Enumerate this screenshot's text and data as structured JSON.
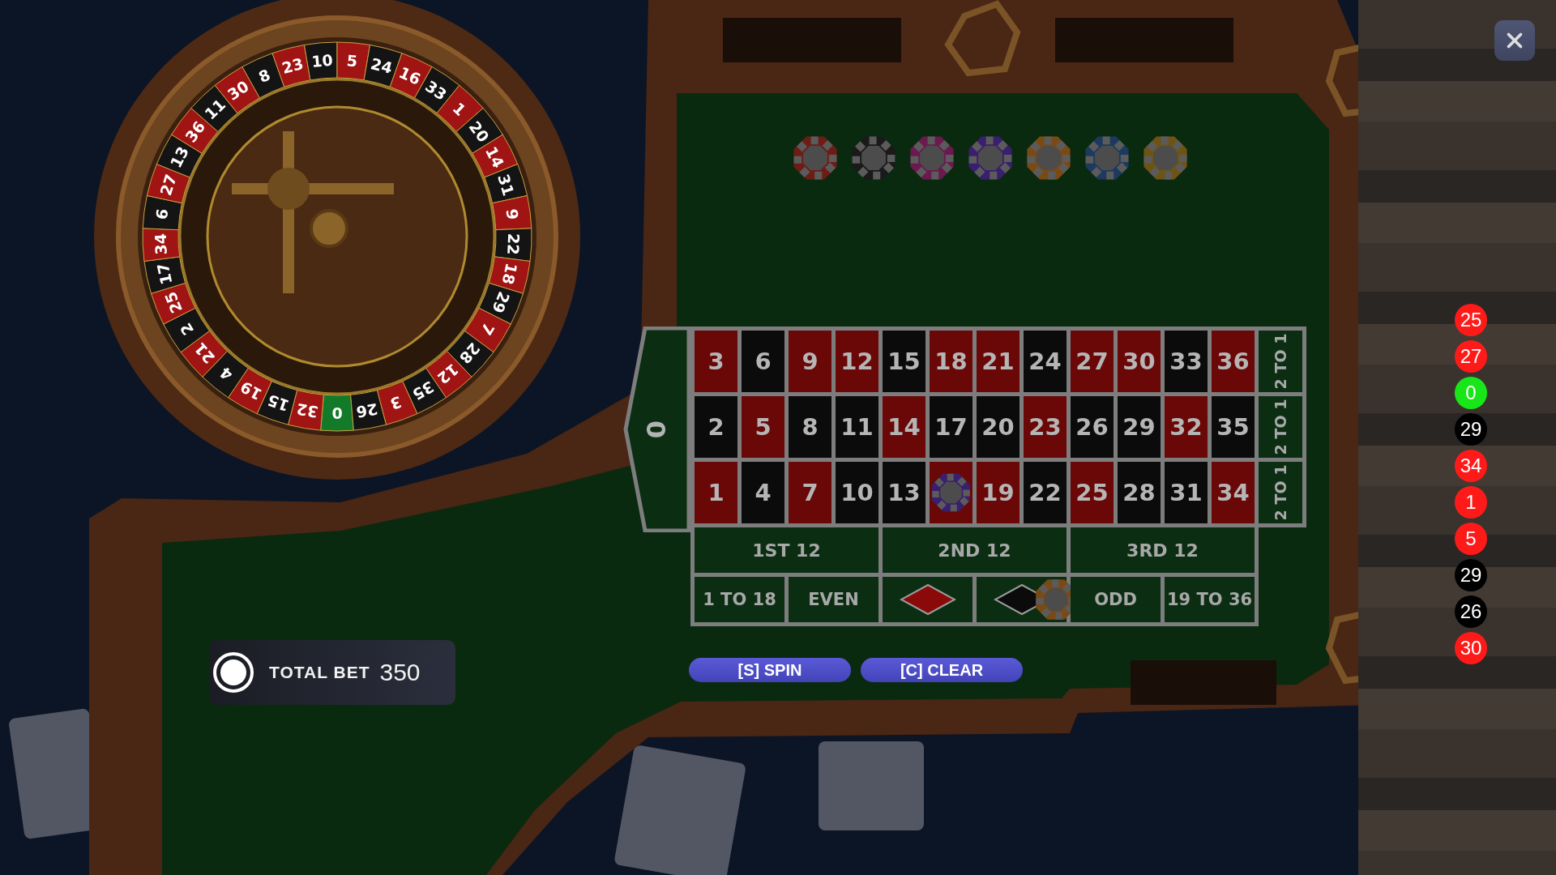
{
  "wheel": {
    "pockets": [
      {
        "number": "0",
        "color": "#137a2a"
      },
      {
        "number": "32",
        "color": "#a01414"
      },
      {
        "number": "15",
        "color": "#141414"
      },
      {
        "number": "19",
        "color": "#a01414"
      },
      {
        "number": "4",
        "color": "#141414"
      },
      {
        "number": "21",
        "color": "#a01414"
      },
      {
        "number": "2",
        "color": "#141414"
      },
      {
        "number": "25",
        "color": "#a01414"
      },
      {
        "number": "17",
        "color": "#141414"
      },
      {
        "number": "34",
        "color": "#a01414"
      },
      {
        "number": "6",
        "color": "#141414"
      },
      {
        "number": "27",
        "color": "#a01414"
      },
      {
        "number": "13",
        "color": "#141414"
      },
      {
        "number": "36",
        "color": "#a01414"
      },
      {
        "number": "11",
        "color": "#141414"
      },
      {
        "number": "30",
        "color": "#a01414"
      },
      {
        "number": "8",
        "color": "#141414"
      },
      {
        "number": "23",
        "color": "#a01414"
      },
      {
        "number": "10",
        "color": "#141414"
      },
      {
        "number": "5",
        "color": "#a01414"
      },
      {
        "number": "24",
        "color": "#141414"
      },
      {
        "number": "16",
        "color": "#a01414"
      },
      {
        "number": "33",
        "color": "#141414"
      },
      {
        "number": "1",
        "color": "#a01414"
      },
      {
        "number": "20",
        "color": "#141414"
      },
      {
        "number": "14",
        "color": "#a01414"
      },
      {
        "number": "31",
        "color": "#141414"
      },
      {
        "number": "9",
        "color": "#a01414"
      },
      {
        "number": "22",
        "color": "#141414"
      },
      {
        "number": "18",
        "color": "#a01414"
      },
      {
        "number": "29",
        "color": "#141414"
      },
      {
        "number": "7",
        "color": "#a01414"
      },
      {
        "number": "28",
        "color": "#141414"
      },
      {
        "number": "12",
        "color": "#a01414"
      },
      {
        "number": "35",
        "color": "#141414"
      },
      {
        "number": "3",
        "color": "#a01414"
      },
      {
        "number": "26",
        "color": "#141414"
      }
    ]
  },
  "chip_rack": [
    {
      "color": "#6b1d16"
    },
    {
      "color": "#1a1a1a"
    },
    {
      "color": "#6a1a4e"
    },
    {
      "color": "#3a1f6e"
    },
    {
      "color": "#7a4a14"
    },
    {
      "color": "#1d3a5e"
    },
    {
      "color": "#6e5414"
    }
  ],
  "board": {
    "zero": "0",
    "rows": [
      [
        {
          "number": "3",
          "color": "#6a0707"
        },
        {
          "number": "6",
          "color": "#0b0b0b"
        },
        {
          "number": "9",
          "color": "#6a0707"
        },
        {
          "number": "12",
          "color": "#6a0707"
        },
        {
          "number": "15",
          "color": "#0b0b0b"
        },
        {
          "number": "18",
          "color": "#6a0707"
        },
        {
          "number": "21",
          "color": "#6a0707"
        },
        {
          "number": "24",
          "color": "#0b0b0b"
        },
        {
          "number": "27",
          "color": "#6a0707"
        },
        {
          "number": "30",
          "color": "#6a0707"
        },
        {
          "number": "33",
          "color": "#0b0b0b"
        },
        {
          "number": "36",
          "color": "#6a0707"
        }
      ],
      [
        {
          "number": "2",
          "color": "#0b0b0b"
        },
        {
          "number": "5",
          "color": "#6a0707"
        },
        {
          "number": "8",
          "color": "#0b0b0b"
        },
        {
          "number": "11",
          "color": "#0b0b0b"
        },
        {
          "number": "14",
          "color": "#6a0707"
        },
        {
          "number": "17",
          "color": "#0b0b0b"
        },
        {
          "number": "20",
          "color": "#0b0b0b"
        },
        {
          "number": "23",
          "color": "#6a0707"
        },
        {
          "number": "26",
          "color": "#0b0b0b"
        },
        {
          "number": "29",
          "color": "#0b0b0b"
        },
        {
          "number": "32",
          "color": "#6a0707"
        },
        {
          "number": "35",
          "color": "#0b0b0b"
        }
      ],
      [
        {
          "number": "1",
          "color": "#6a0707"
        },
        {
          "number": "4",
          "color": "#0b0b0b"
        },
        {
          "number": "7",
          "color": "#6a0707"
        },
        {
          "number": "10",
          "color": "#0b0b0b"
        },
        {
          "number": "13",
          "color": "#0b0b0b"
        },
        {
          "color": "#6a0707",
          "chip": {
            "color": "#3a1f6e"
          }
        },
        {
          "number": "19",
          "color": "#6a0707"
        },
        {
          "number": "22",
          "color": "#0b0b0b"
        },
        {
          "number": "25",
          "color": "#6a0707"
        },
        {
          "number": "28",
          "color": "#0b0b0b"
        },
        {
          "number": "31",
          "color": "#0b0b0b"
        },
        {
          "number": "34",
          "color": "#6a0707"
        }
      ]
    ],
    "column_bets": [
      "2 TO 1",
      "2 TO 1",
      "2 TO 1"
    ],
    "dozens": [
      "1ST 12",
      "2ND 12",
      "3RD 12"
    ],
    "outside": [
      {
        "kind": "text",
        "label": "1 TO 18"
      },
      {
        "kind": "text",
        "label": "EVEN"
      },
      {
        "kind": "diamond",
        "color": "#8a0a0a"
      },
      {
        "kind": "diamond",
        "color": "#0b0b0b",
        "chip": {
          "color": "#7a4a14"
        }
      },
      {
        "kind": "text",
        "label": "ODD"
      },
      {
        "kind": "text",
        "label": "19 TO 36"
      }
    ]
  },
  "total_bet": {
    "label": "TOTAL BET",
    "value": "350"
  },
  "buttons": [
    "[S] SPIN",
    "[C] CLEAR"
  ],
  "history": [
    {
      "number": "25",
      "color": "#ff1a1a"
    },
    {
      "number": "27",
      "color": "#ff1a1a"
    },
    {
      "number": "0",
      "color": "#19e619"
    },
    {
      "number": "29",
      "color": "#000000"
    },
    {
      "number": "34",
      "color": "#ff1a1a"
    },
    {
      "number": "1",
      "color": "#ff1a1a"
    },
    {
      "number": "5",
      "color": "#ff1a1a"
    },
    {
      "number": "29",
      "color": "#000000"
    },
    {
      "number": "26",
      "color": "#000000"
    },
    {
      "number": "30",
      "color": "#ff1a1a"
    }
  ]
}
